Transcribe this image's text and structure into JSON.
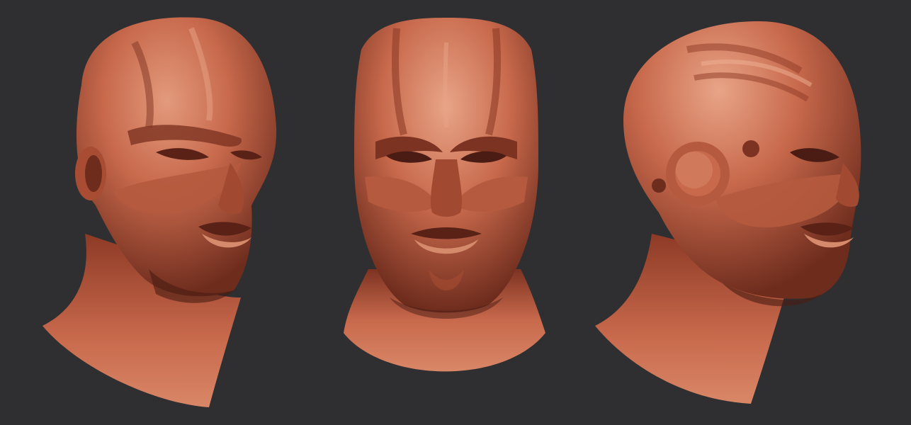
{
  "scene": {
    "background_color": "#2f2f31",
    "material_colors": {
      "base": "#c8694c",
      "highlight": "#e39a7c",
      "shadow": "#6e2c1d",
      "deep_shadow": "#4a1c13"
    },
    "views": [
      {
        "name": "three-quarter-left"
      },
      {
        "name": "front"
      },
      {
        "name": "three-quarter-right"
      }
    ]
  }
}
